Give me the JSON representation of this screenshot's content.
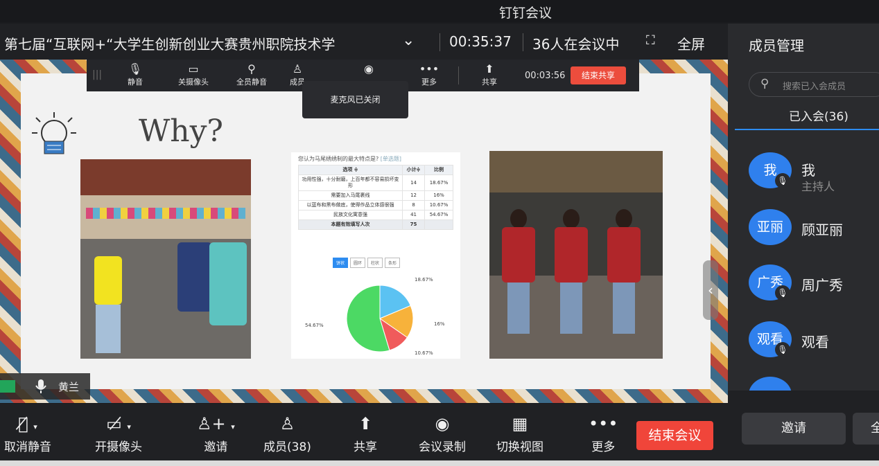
{
  "app_title": "钉钉会议",
  "meeting": {
    "title": "第七届“互联网+“大学生创新创业大赛贵州职院技术学",
    "duration": "00:35:37",
    "participants": "36人在会议中",
    "fullscreen_label": "全屏"
  },
  "share_toolbar": {
    "mute": "静音",
    "camera_off": "关摄像头",
    "mute_all": "全员静音",
    "members": "成员",
    "more": "更多",
    "share": "共享",
    "share_time": "00:03:56",
    "end_share": "结束共享"
  },
  "tooltip": "麦克风已关闭",
  "slide": {
    "heading": "Why?",
    "survey": {
      "question": "您认为马尾绣绣制的最大特点是?",
      "tag": "[单选题]",
      "headers": [
        "选项 ≑",
        "小计≑",
        "比例"
      ],
      "rows": [
        [
          "功用性强，十分耐磨，上百年都不容易损坏变形",
          "14",
          "18.67%"
        ],
        [
          "需要加入马尾裹线",
          "12",
          "16%"
        ],
        [
          "以蓝布和黑布做底，使得作品立体感很强",
          "8",
          "10.67%"
        ],
        [
          "民族文化寓意强",
          "41",
          "54.67%"
        ]
      ],
      "total": [
        "本题有效填写人次",
        "75",
        ""
      ],
      "chart_tabs": [
        "饼状",
        "圆环",
        "柱状",
        "条形"
      ]
    }
  },
  "chart_data": {
    "type": "pie",
    "categories": [
      "功用性强，十分耐磨，上百年都不容易损坏变形",
      "需要加入马尾裹线",
      "以蓝布和黑布做底，使得作品立体感很强",
      "民族文化寓意强"
    ],
    "values": [
      18.67,
      16,
      10.67,
      54.67
    ],
    "labels": [
      "18.67%",
      "16%",
      "10.67%",
      "54.67%"
    ],
    "colors": [
      "#5bc2f2",
      "#f7b23b",
      "#f05b5b",
      "#4cd964"
    ]
  },
  "speaker": {
    "name": "黄兰"
  },
  "bottom_bar": {
    "unmute": "取消静音",
    "camera_on": "开摄像头",
    "invite": "邀请",
    "members": "成员(38)",
    "share": "共享",
    "record": "会议录制",
    "switch_view": "切换视图",
    "more": "更多",
    "end_meeting": "结束会议"
  },
  "panel": {
    "title": "成员管理",
    "search_placeholder": "搜索已入会成员",
    "tab": "已入会(36)",
    "members": [
      {
        "avatar": "我",
        "name": "我",
        "role": "主持人"
      },
      {
        "avatar": "亚丽",
        "name": "顾亚丽",
        "role": ""
      },
      {
        "avatar": "广秀",
        "name": "周广秀",
        "role": ""
      },
      {
        "avatar": "观看",
        "name": "观看",
        "role": ""
      }
    ],
    "invite": "邀请",
    "more_btn": "全"
  }
}
